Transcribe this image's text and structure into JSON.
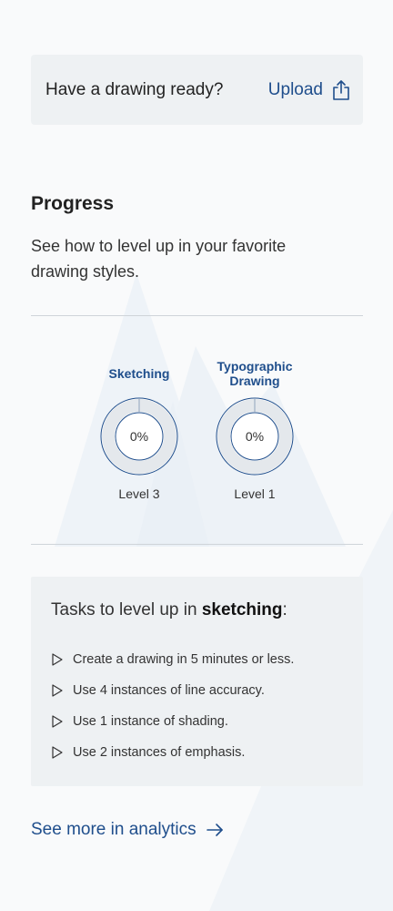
{
  "upload_card": {
    "prompt": "Have a drawing ready?",
    "upload_label": "Upload"
  },
  "progress": {
    "title": "Progress",
    "description": "See how to level up in your favorite drawing styles."
  },
  "skills": [
    {
      "name": "Sketching",
      "percent_label": "0%",
      "level": "Level 3",
      "progress": 0
    },
    {
      "name": "Typographic Drawing",
      "percent_label": "0%",
      "level": "Level 1",
      "progress": 0
    }
  ],
  "tasks": {
    "heading_prefix": "Tasks to level up in ",
    "heading_skill": "sketching",
    "heading_suffix": ":",
    "items": [
      "Create a drawing in 5 minutes or less.",
      "Use 4 instances of line accuracy.",
      "Use 1 instance of shading.",
      "Use 2 instances of emphasis."
    ]
  },
  "footer": {
    "analytics_link": "See more in analytics"
  },
  "colors": {
    "accent": "#1f4e8c",
    "card_bg": "#eef1f3",
    "page_bg": "#f9fafb"
  },
  "icons": {
    "upload": "share-upload-icon",
    "task_bullet": "triangle-play-icon",
    "link_arrow": "arrow-right-icon"
  }
}
